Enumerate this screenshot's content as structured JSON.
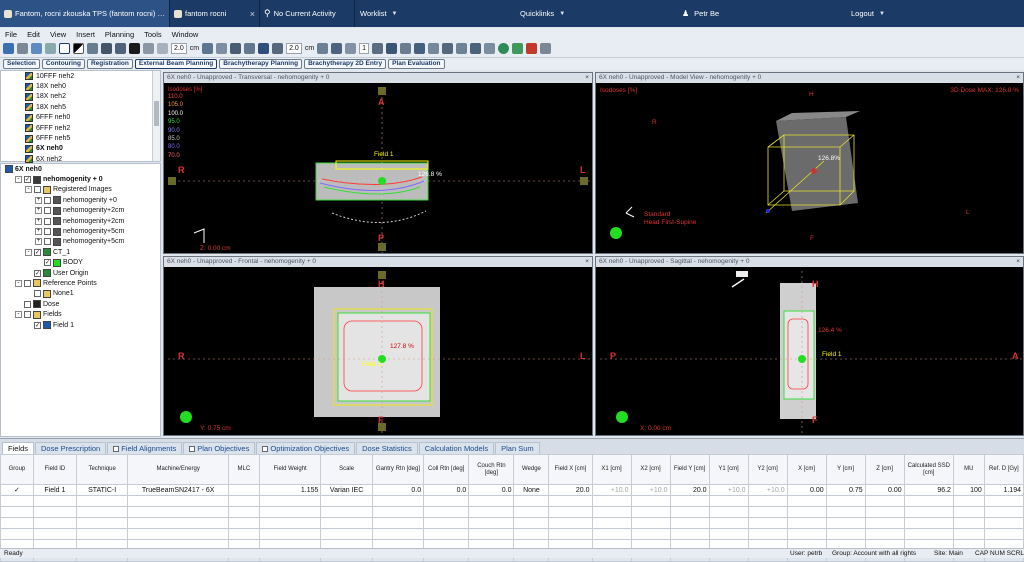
{
  "window": {
    "tabs": [
      {
        "label": "Fantom, rocni zkouska TPS (fantom rocni) - External Beam Planning",
        "active": true
      },
      {
        "label": "fantom rocni",
        "active": false
      }
    ],
    "current_activity": "No Current Activity",
    "worklist": "Worklist",
    "quicklinks": "Quicklinks",
    "user": "Petr Be",
    "logout": "Logout"
  },
  "menu": [
    "File",
    "Edit",
    "View",
    "Insert",
    "Planning",
    "Tools",
    "Window"
  ],
  "toolbar": {
    "zoom1": "2.0",
    "unit1": "cm",
    "zoom2": "2.0",
    "unit2": "cm",
    "slice": "1"
  },
  "workspaces": [
    {
      "label": "Selection",
      "active": false
    },
    {
      "label": "Contouring",
      "active": false
    },
    {
      "label": "Registration",
      "active": false
    },
    {
      "label": "External Beam Planning",
      "active": true
    },
    {
      "label": "Brachytherapy Planning",
      "active": false
    },
    {
      "label": "Brachytherapy 2D Entry",
      "active": false
    },
    {
      "label": "Plan Evaluation",
      "active": false
    }
  ],
  "plans": [
    {
      "label": "10FFF neh2",
      "bold": false
    },
    {
      "label": "18X neh0",
      "bold": false
    },
    {
      "label": "18X neh2",
      "bold": false
    },
    {
      "label": "18X neh5",
      "bold": false
    },
    {
      "label": "6FFF neh0",
      "bold": false
    },
    {
      "label": "6FFF neh2",
      "bold": false
    },
    {
      "label": "6FFF neh5",
      "bold": false
    },
    {
      "label": "6X neh0",
      "bold": true
    },
    {
      "label": "6X neh2",
      "bold": false
    }
  ],
  "tree": [
    {
      "label": "6X neh0",
      "indent": 0,
      "bold": true,
      "icon": "plan"
    },
    {
      "label": "nehomogenity + 0",
      "indent": 1,
      "bold": true,
      "icon": "image-set",
      "exp": "-",
      "cb": "✓"
    },
    {
      "label": "Registered Images",
      "indent": 2,
      "icon": "folder",
      "exp": "-",
      "cb": ""
    },
    {
      "label": "nehomogenity +0",
      "indent": 3,
      "icon": "image",
      "exp": "+",
      "cb": ""
    },
    {
      "label": "nehomogenity+2cm",
      "indent": 3,
      "icon": "image",
      "exp": "+",
      "cb": ""
    },
    {
      "label": "nehomogenity+2cm",
      "indent": 3,
      "icon": "image",
      "exp": "+",
      "cb": ""
    },
    {
      "label": "nehomogenity+5cm",
      "indent": 3,
      "icon": "image",
      "exp": "+",
      "cb": ""
    },
    {
      "label": "nehomogenity+5cm",
      "indent": 3,
      "icon": "image",
      "exp": "+",
      "cb": ""
    },
    {
      "label": "CT_1",
      "indent": 2,
      "icon": "structure-set",
      "exp": "-",
      "cb": "✓"
    },
    {
      "label": "BODY",
      "indent": 3,
      "icon": "body",
      "exp": "",
      "cb": "✓"
    },
    {
      "label": "User Origin",
      "indent": 2,
      "icon": "origin",
      "exp": "",
      "cb": "✓"
    },
    {
      "label": "Reference Points",
      "indent": 1,
      "icon": "folder",
      "exp": "-",
      "cb": ""
    },
    {
      "label": "None1",
      "indent": 2,
      "icon": "point",
      "exp": "",
      "cb": ""
    },
    {
      "label": "Dose",
      "indent": 1,
      "icon": "dose",
      "exp": "",
      "cb": ""
    },
    {
      "label": "Fields",
      "indent": 1,
      "icon": "folder",
      "exp": "-",
      "cb": ""
    },
    {
      "label": "Field 1",
      "indent": 2,
      "icon": "field",
      "exp": "",
      "cb": "✓"
    }
  ],
  "viewports": {
    "transversal": {
      "title": "6X neh0 - Unapproved - Transversal - nehomogenity + 0",
      "field": "Field 1",
      "top": "A",
      "bottom": "P",
      "left": "R",
      "right": "L",
      "zpos": "Z: 0.00 cm",
      "pct": "126.8 %",
      "isodose_title": "Isodoses [%]",
      "isodoses": [
        {
          "v": "110.0",
          "c": "#ff3b3b"
        },
        {
          "v": "105.0",
          "c": "#ff9b3b"
        },
        {
          "v": "100.0",
          "c": "#ffffff"
        },
        {
          "v": "95.0",
          "c": "#3bdc3b"
        },
        {
          "v": "90.0",
          "c": "#8a8cff"
        },
        {
          "v": "85.0",
          "c": "#c9c9c9"
        },
        {
          "v": "80.0",
          "c": "#7f6bff"
        },
        {
          "v": "70.0",
          "c": "#ff7070"
        }
      ]
    },
    "model": {
      "title": "6X neh0 - Unapproved - Model View - nehomogenity + 0",
      "isodose_title": "Isodoses [%]",
      "dose_max": "3D Dose MAX: 126.8 %",
      "pct": "126.8%",
      "orient1": "Standard",
      "orient2": "Head First-Supine",
      "h": "H",
      "r": "R",
      "l": "L",
      "f": "F"
    },
    "frontal": {
      "title": "6X neh0 - Unapproved - Frontal - nehomogenity + 0",
      "top": "H",
      "bottom": "F",
      "left": "R",
      "right": "L",
      "ypos": "Y: 0.75 cm",
      "pct": "127.8 %",
      "field": "Field 1"
    },
    "sagittal": {
      "title": "6X neh0 - Unapproved - Sagittal - nehomogenity + 0",
      "top": "H",
      "bottom": "F",
      "left": "P",
      "right": "A",
      "xpos": "X: 0.00 cm",
      "pct": "126.4 %",
      "field": "Field 1"
    }
  },
  "bottom_tabs": [
    {
      "label": "Fields",
      "active": true,
      "cb": false
    },
    {
      "label": "Dose Prescription",
      "active": false,
      "cb": false
    },
    {
      "label": "Field Alignments",
      "active": false,
      "cb": true
    },
    {
      "label": "Plan Objectives",
      "active": false,
      "cb": true
    },
    {
      "label": "Optimization Objectives",
      "active": false,
      "cb": true
    },
    {
      "label": "Dose Statistics",
      "active": false,
      "cb": false
    },
    {
      "label": "Calculation Models",
      "active": false,
      "cb": false
    },
    {
      "label": "Plan Sum",
      "active": false,
      "cb": false
    }
  ],
  "table": {
    "headers": [
      "Group",
      "Field ID",
      "Technique",
      "Machine/Energy",
      "MLC",
      "Field Weight",
      "Scale",
      "Gantry Rtn [deg]",
      "Coll Rtn [deg]",
      "Couch Rtn [deg]",
      "Wedge",
      "Field X [cm]",
      "X1 [cm]",
      "X2 [cm]",
      "Field Y [cm]",
      "Y1 [cm]",
      "Y2 [cm]",
      "X [cm]",
      "Y [cm]",
      "Z [cm]",
      "Calculated SSD [cm]",
      "MU",
      "Ref. D [Gy]"
    ],
    "rows": [
      [
        "✓",
        "Field 1",
        "STATIC-I",
        "TrueBeamSN2417 - 6X",
        "",
        "1.155",
        "Varian IEC",
        "0.0",
        "0.0",
        "0.0",
        "None",
        "20.0",
        "+10.0",
        "+10.0",
        "20.0",
        "+10.0",
        "+10.0",
        "0.00",
        "0.75",
        "0.00",
        "96.2",
        "100",
        "1.194"
      ]
    ]
  },
  "status": {
    "left": "Ready",
    "user": "User: petrb",
    "group": "Group: Account with all rights",
    "site": "Site: Main",
    "caps": "CAP NUM SCRL"
  }
}
